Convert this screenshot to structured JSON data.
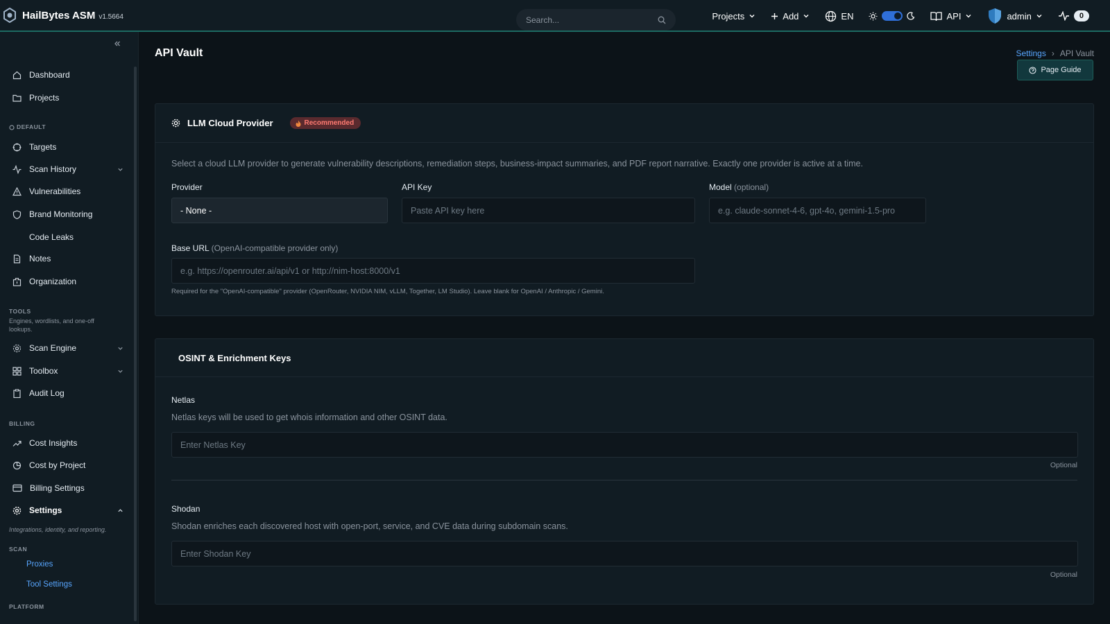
{
  "header": {
    "brand": "HailBytes ASM",
    "version": "v1.5664",
    "search_placeholder": "Search...",
    "projects": "Projects",
    "add": "Add",
    "lang": "EN",
    "api": "API",
    "user": "admin",
    "notif_count": "0"
  },
  "sidebar": {
    "items_top": [
      "Dashboard",
      "Projects"
    ],
    "sec_default": "DEFAULT",
    "items_default": [
      "Targets",
      "Scan History",
      "Vulnerabilities",
      "Brand Monitoring",
      "Code Leaks",
      "Notes",
      "Organization"
    ],
    "sec_tools": "TOOLS",
    "tools_sub": "Engines, wordlists, and one-off lookups.",
    "items_tools": [
      "Scan Engine",
      "Toolbox",
      "Audit Log"
    ],
    "sec_billing": "BILLING",
    "items_billing": [
      "Cost Insights",
      "Cost by Project",
      "Billing Settings"
    ],
    "settings": "Settings",
    "settings_sub": "Integrations, identity, and reporting.",
    "sec_scan": "SCAN",
    "scan_links": [
      "Proxies",
      "Tool Settings"
    ],
    "sec_platform": "PLATFORM"
  },
  "page": {
    "title": "API Vault",
    "breadcrumb_parent": "Settings",
    "breadcrumb_current": "API Vault",
    "guide": "Page Guide"
  },
  "llm": {
    "title": "LLM Cloud Provider",
    "badge": "Recommended",
    "desc": "Select a cloud LLM provider to generate vulnerability descriptions, remediation steps, business-impact summaries, and PDF report narrative. Exactly one provider is active at a time.",
    "provider_label": "Provider",
    "provider_value": "- None -",
    "apikey_label": "API Key",
    "apikey_placeholder": "Paste API key here",
    "model_label": "Model",
    "model_opt": "(optional)",
    "model_placeholder": "e.g. claude-sonnet-4-6, gpt-4o, gemini-1.5-pro",
    "baseurl_label": "Base URL",
    "baseurl_opt": "(OpenAI-compatible provider only)",
    "baseurl_placeholder": "e.g. https://openrouter.ai/api/v1 or http://nim-host:8000/v1",
    "baseurl_hint": "Required for the \"OpenAI-compatible\" provider (OpenRouter, NVIDIA NIM, vLLM, Together, LM Studio). Leave blank for OpenAI / Anthropic / Gemini."
  },
  "osint": {
    "title": "OSINT & Enrichment Keys",
    "netlas_label": "Netlas",
    "netlas_desc": "Netlas keys will be used to get whois information and other OSINT data.",
    "netlas_placeholder": "Enter Netlas Key",
    "shodan_label": "Shodan",
    "shodan_desc": "Shodan enriches each discovered host with open-port, service, and CVE data during subdomain scans.",
    "shodan_placeholder": "Enter Shodan Key",
    "optional": "Optional"
  }
}
